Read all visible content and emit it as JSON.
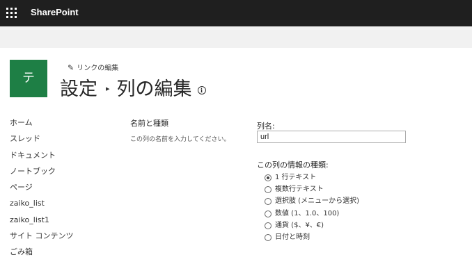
{
  "suite_bar": {
    "brand": "SharePoint"
  },
  "site": {
    "logo_letter": "テ",
    "edit_links": "リンクの編集"
  },
  "title": {
    "parent": "設定",
    "separator": "▸",
    "current": "列の編集",
    "info_glyph": "i"
  },
  "nav": {
    "items": [
      "ホーム",
      "スレッド",
      "ドキュメント",
      "ノートブック",
      "ページ",
      "zaiko_list",
      "zaiko_list1",
      "サイト コンテンツ",
      "ごみ箱"
    ]
  },
  "section": {
    "heading": "名前と種類",
    "description": "この列の名前を入力してください。"
  },
  "column_name": {
    "label": "列名:",
    "value": "url"
  },
  "column_type": {
    "label": "この列の情報の種類:",
    "options": [
      "1 行テキスト",
      "複数行テキスト",
      "選択肢 (メニューから選択)",
      "数値 (1、1.0、100)",
      "通貨 ($、¥、€)",
      "日付と時刻"
    ],
    "selected": "1 行テキスト"
  },
  "colors": {
    "suite_bar": "#1f1f1f",
    "logo_bg": "#1e7f45",
    "sub_bar": "#f1f1f1"
  },
  "icons": [
    "app-launcher-icon",
    "pencil-icon",
    "info-icon",
    "radio-icon"
  ]
}
